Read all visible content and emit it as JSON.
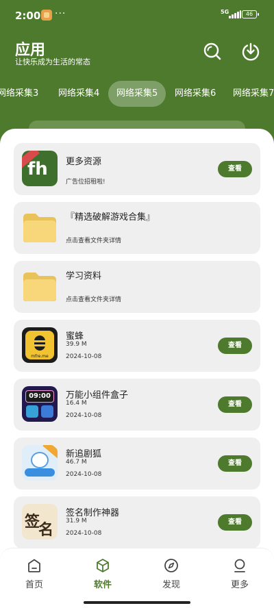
{
  "status_bar": {
    "time": "2:00",
    "dots": "···",
    "network": "5G",
    "battery": "46"
  },
  "header": {
    "title": "应用",
    "subtitle": "让快乐成为生活的常态",
    "icons": [
      "search-icon",
      "download-icon"
    ]
  },
  "tabs": [
    "网络采集3",
    "网络采集4",
    "网络采集5",
    "网络采集6",
    "网络采集7"
  ],
  "active_tab": "网络采集5",
  "items": [
    {
      "name": "更多资源",
      "desc": "广告位招租啦!",
      "button": "查看",
      "icon": "fh-app-icon"
    },
    {
      "name": "『精选破解游戏合集』",
      "desc": "点击查看文件夹详情",
      "icon": "folder-icon"
    },
    {
      "name": "学习资料",
      "desc": "点击查看文件夹详情",
      "icon": "folder-icon"
    },
    {
      "name": "蜜蜂",
      "size": "39.9 M",
      "date": "2024-10-08",
      "button": "查看",
      "icon": "bee-app-icon",
      "icon_text": "mfre.me"
    },
    {
      "name": "万能小组件盒子",
      "size": "16.4 M",
      "date": "2024-10-08",
      "button": "查看",
      "icon": "widget-box-icon",
      "icon_text": "09:00"
    },
    {
      "name": "新追剧狐",
      "size": "46.7 M",
      "date": "2024-10-08",
      "button": "查看",
      "icon": "fox-app-icon"
    },
    {
      "name": "签名制作神器",
      "size": "31.9 M",
      "date": "2024-10-08",
      "button": "查看",
      "icon": "signature-app-icon"
    }
  ],
  "fh_icon_text": "fh",
  "sign_icon_text": [
    "签",
    "名"
  ],
  "bottom_nav": [
    {
      "label": "首页",
      "icon": "home-icon"
    },
    {
      "label": "软件",
      "icon": "cube-icon"
    },
    {
      "label": "发现",
      "icon": "compass-icon"
    },
    {
      "label": "更多",
      "icon": "user-icon"
    }
  ],
  "active_nav": "软件",
  "colors": {
    "accent": "#4e7a2e",
    "card": "#efefef",
    "folder": "#f7d77a"
  }
}
